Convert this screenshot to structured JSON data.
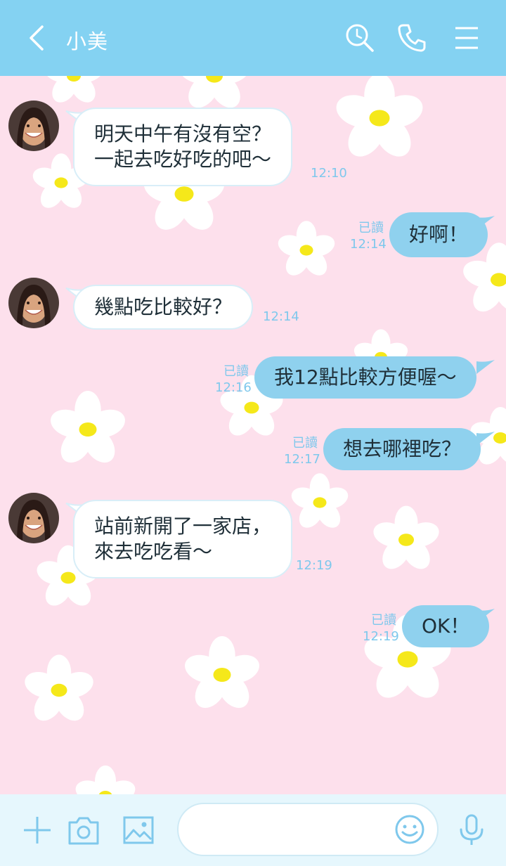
{
  "header": {
    "title": "小美"
  },
  "messages": [
    {
      "side": "in",
      "text_lines": [
        "明天中午有沒有空？",
        "一起去吃好吃的吧～"
      ],
      "time": "12:10"
    },
    {
      "side": "out",
      "text": "好啊！",
      "read": "已讀",
      "time": "12:14"
    },
    {
      "side": "in",
      "text": "幾點吃比較好？",
      "time": "12:14"
    },
    {
      "side": "out",
      "text": "我12點比較方便喔～",
      "read": "已讀",
      "time": "12:16"
    },
    {
      "side": "out",
      "text": "想去哪裡吃？",
      "read": "已讀",
      "time": "12:17"
    },
    {
      "side": "in",
      "text_lines": [
        "站前新開了一家店，",
        "來去吃吃看～"
      ],
      "time": "12:19"
    },
    {
      "side": "out",
      "text": "OK！",
      "read": "已讀",
      "time": "12:19"
    }
  ],
  "footer": {
    "input_placeholder": ""
  },
  "icons": {
    "back": "chevron-left-icon",
    "search": "search-clock-icon",
    "call": "phone-icon",
    "menu": "hamburger-menu-icon",
    "add": "plus-icon",
    "camera": "camera-icon",
    "image": "image-icon",
    "emoji": "smiley-icon",
    "mic": "microphone-icon"
  },
  "colors": {
    "header_bg": "#84d2f2",
    "chat_bg": "#fde0ec",
    "out_bubble": "#8fd1ee",
    "in_bubble": "#ffffff",
    "meta_text": "#7fc8ec",
    "footer_bg": "#e6f7fd"
  }
}
